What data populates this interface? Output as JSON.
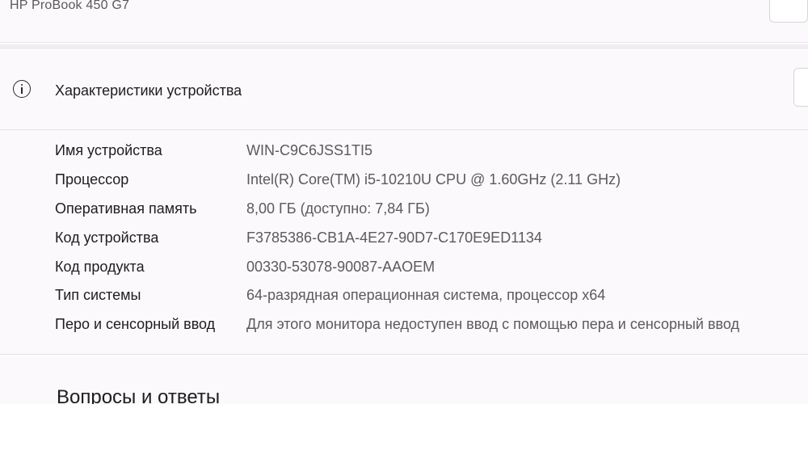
{
  "device": {
    "model_name": "HP ProBook 450 G7"
  },
  "specifications": {
    "title": "Характеристики устройства",
    "rows": [
      {
        "label": "Имя устройства",
        "value": "WIN-C9C6JSS1TI5"
      },
      {
        "label": "Процессор",
        "value": "Intel(R) Core(TM) i5-10210U CPU @ 1.60GHz (2.11 GHz)"
      },
      {
        "label": "Оперативная память",
        "value": "8,00 ГБ (доступно: 7,84 ГБ)"
      },
      {
        "label": "Код устройства",
        "value": "F3785386-CB1A-4E27-90D7-C170E9ED1134"
      },
      {
        "label": "Код продукта",
        "value": "00330-53078-90087-AAOEM"
      },
      {
        "label": "Тип системы",
        "value": "64-разрядная операционная система, процессор x64"
      },
      {
        "label": "Перо и сенсорный ввод",
        "value": "Для этого монитора недоступен ввод с помощью пера и сенсорный ввод"
      }
    ]
  },
  "faq": {
    "title": "Вопросы и ответы"
  },
  "icons": {
    "spec_header_icon": "info-icon"
  }
}
